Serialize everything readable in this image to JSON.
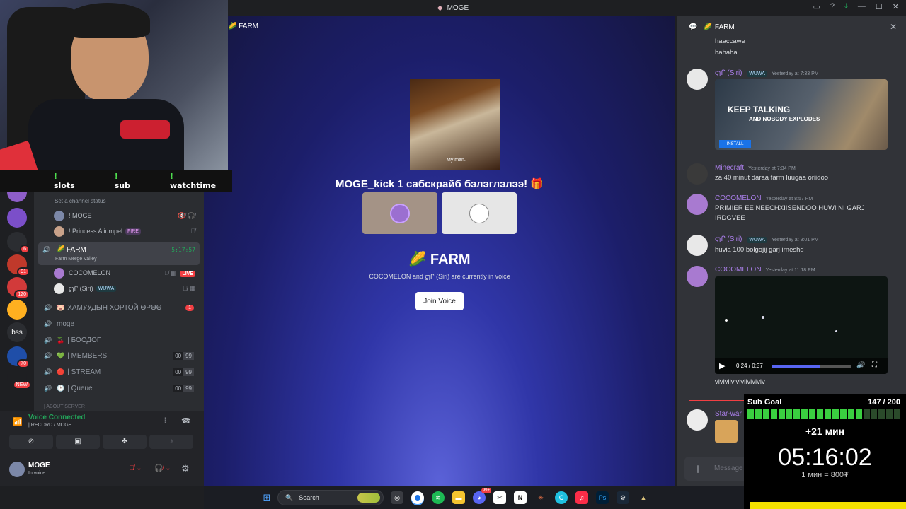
{
  "titlebar": {
    "title": "MOGE"
  },
  "servers": [
    {
      "label": "",
      "color": "#8e5ec9",
      "badge": ""
    },
    {
      "label": "",
      "color": "#7b4fc9",
      "badge": ""
    },
    {
      "label": "",
      "color": "#2b2d31",
      "badge": "6"
    },
    {
      "label": "",
      "color": "#c0392b",
      "badge": "91"
    },
    {
      "label": "",
      "color": "#d23a3a",
      "badge": "120"
    },
    {
      "label": "",
      "color": "#ffb020",
      "badge": ""
    },
    {
      "label": "bss",
      "color": "#2b2d31",
      "badge": ""
    },
    {
      "label": "",
      "color": "#1f4ea8",
      "badge": "70"
    },
    {
      "label": "",
      "color": "#1e1f22",
      "badge": "NEW"
    }
  ],
  "sidebar": {
    "channel_status": "Set a channel status",
    "users_top": [
      {
        "name": "! MOGE",
        "tag": ""
      },
      {
        "name": "! Princess Aliumpel",
        "tag": "FIRE"
      }
    ],
    "active_channel": {
      "name": "FARM",
      "subtitle": "Farm Merge Valley",
      "timer": "5:17:57"
    },
    "voice_users": [
      {
        "name": "COCOMELON",
        "tag": "LIVE"
      },
      {
        "name": "ϛɿᒋ (Siri)",
        "tag": "WUWA"
      }
    ],
    "channels": [
      {
        "name": "ХАМУУДЫН ХОРТОЙ ӨРӨӨ",
        "emoji": "🐷",
        "badge": "1",
        "counts": []
      },
      {
        "name": "moge",
        "emoji": "",
        "badge": "",
        "counts": []
      },
      {
        "name": "| БООДОГ",
        "emoji": "🍒",
        "badge": "",
        "counts": []
      },
      {
        "name": "| MEMBERS",
        "emoji": "💚",
        "badge": "",
        "counts": [
          "00",
          "99"
        ]
      },
      {
        "name": "| STREAM",
        "emoji": "🔴",
        "badge": "",
        "counts": [
          "00",
          "99"
        ]
      },
      {
        "name": "| Queue",
        "emoji": "🕒",
        "badge": "",
        "counts": [
          "00",
          "99"
        ]
      }
    ],
    "category_cut": "| ABOUT SERVER"
  },
  "voice_panel": {
    "status": "Voice Connected",
    "location": "| RECORD / MOGE",
    "user_name": "MOGE",
    "user_status": "In voice"
  },
  "stage": {
    "header": "FARM",
    "gif_caption": "My man.",
    "sub_title": "MOGE_kick 1 сабскрайб бэлэглэлээ! 🎁",
    "farm_title": "FARM",
    "farm_desc": "COCOMELON and ϛɿᒋ (Siri) are currently in voice",
    "join_label": "Join Voice"
  },
  "chat": {
    "header": "FARM",
    "messages": [
      {
        "name": "",
        "ts": "",
        "lines": [
          "haaccawe",
          "hahaha"
        ]
      },
      {
        "name": "ϛɿᒋ (Siri)",
        "tag": "WUWA",
        "ts": "Yesterday at 7:33 PM",
        "embed_title": "KEEP TALKING",
        "embed_sub": "AND NOBODY EXPLODES",
        "embed_btn": "INSTALL"
      },
      {
        "name": "Minecraft",
        "ts": "Yesterday at 7:34 PM",
        "lines": [
          "za 40 minut daraa farm luugaa oriidoo"
        ]
      },
      {
        "name": "COCOMELON",
        "ts": "Yesterday at 8:57 PM",
        "lines": [
          "PRIMIER EE NEECHXIISENDOO HUWI NI GARJ IRDGVEE"
        ]
      },
      {
        "name": "ϛɿᒋ (Siri)",
        "tag": "WUWA",
        "ts": "Yesterday at 9:01 PM",
        "lines": [
          "huvia 100 bolgojij garj irneshd"
        ]
      },
      {
        "name": "COCOMELON",
        "ts": "Yesterday at 11:18 PM",
        "video_time": "0:24 / 0:37",
        "lines_after": [
          "vlvlvllvlvlvllvlvlvlv"
        ]
      },
      {
        "name": "Star-war",
        "ts": "",
        "lines": []
      }
    ],
    "composer_placeholder": "Message"
  },
  "taskbar": {
    "search": "Search",
    "notif": "99+"
  },
  "overlay": {
    "commands": [
      "slots",
      "sub",
      "watchtime"
    ],
    "subgoal": {
      "label": "Sub Goal",
      "current": "147",
      "target": "200",
      "display": "147 / 200",
      "progress": 0.735,
      "plus": "+21 мин",
      "timer": "05:16:02",
      "rate": "1 мин = 800₮"
    }
  },
  "colors": {
    "accent": "#5865f2",
    "live": "#f23f43",
    "green": "#23a55a",
    "name_purple": "#a97ee8"
  }
}
